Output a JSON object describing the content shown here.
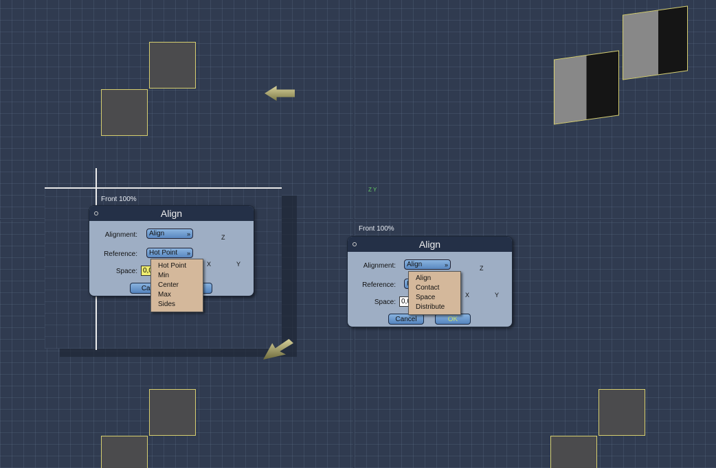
{
  "viewports": {
    "front_label": "Front 100%"
  },
  "left_dialog": {
    "title": "Align",
    "alignment_label": "Alignment:",
    "alignment_value": "Align",
    "reference_label": "Reference:",
    "reference_value": "Hot Point",
    "space_label": "Space:",
    "space_value": "0,0",
    "cancel": "Can",
    "ok": "",
    "menu": [
      "Hot Point",
      "Min",
      "Center",
      "Max",
      "Sides"
    ]
  },
  "right_dialog": {
    "title": "Align",
    "alignment_label": "Alignment:",
    "alignment_value": "Align",
    "reference_label": "Reference:",
    "reference_value": "H",
    "space_label": "Space:",
    "space_value": "0,0",
    "cancel": "Cancel",
    "ok": "OK",
    "menu": [
      "Align",
      "Contact",
      "Space",
      "Distribute"
    ]
  },
  "gizmo": {
    "x": "X",
    "y": "Y",
    "z": "Z"
  },
  "colors": {
    "grid_bg": "#303b50",
    "dialog_bg": "#9eaec4",
    "menu_bg": "#d4b89b",
    "selection": "#d8d070"
  }
}
